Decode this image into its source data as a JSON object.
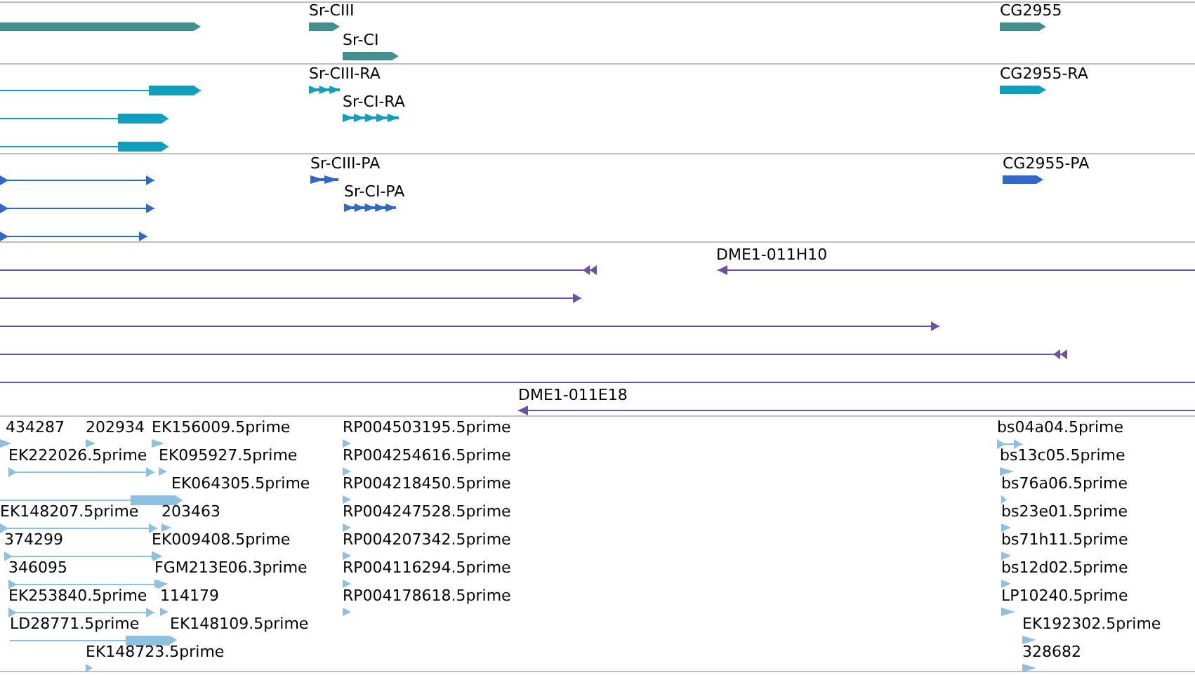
{
  "tracks": [
    {
      "kind": "gene",
      "features": [
        {
          "label": "Sr-CIII"
        },
        {
          "label": "Sr-CI"
        },
        {
          "label": "CG2955"
        }
      ]
    },
    {
      "kind": "transcript",
      "features": [
        {
          "label": "Sr-CIII-RA"
        },
        {
          "label": "Sr-CI-RA"
        },
        {
          "label": "CG2955-RA"
        }
      ]
    },
    {
      "kind": "protein",
      "features": [
        {
          "label": "Sr-CIII-PA"
        },
        {
          "label": "Sr-CI-PA"
        },
        {
          "label": "CG2955-PA"
        }
      ]
    },
    {
      "kind": "clone",
      "features": [
        {
          "label": "DME1-011H10"
        },
        {
          "label": "DME1-011E18"
        }
      ]
    },
    {
      "kind": "est",
      "features": [
        {
          "label": "434287"
        },
        {
          "label": "202934"
        },
        {
          "label": "EK156009.5prime"
        },
        {
          "label": "RP004503195.5prime"
        },
        {
          "label": "bs04a04.5prime"
        },
        {
          "label": "EK222026.5prime"
        },
        {
          "label": "EK095927.5prime"
        },
        {
          "label": "RP004254616.5prime"
        },
        {
          "label": "bs13c05.5prime"
        },
        {
          "label": "EK064305.5prime"
        },
        {
          "label": "RP004218450.5prime"
        },
        {
          "label": "bs76a06.5prime"
        },
        {
          "label": "EK148207.5prime"
        },
        {
          "label": "203463"
        },
        {
          "label": "RP004247528.5prime"
        },
        {
          "label": "bs23e01.5prime"
        },
        {
          "label": "374299"
        },
        {
          "label": "EK009408.5prime"
        },
        {
          "label": "RP004207342.5prime"
        },
        {
          "label": "bs71h11.5prime"
        },
        {
          "label": "346095"
        },
        {
          "label": "FGM213E06.3prime"
        },
        {
          "label": "RP004116294.5prime"
        },
        {
          "label": "bs12d02.5prime"
        },
        {
          "label": "EK253840.5prime"
        },
        {
          "label": "114179"
        },
        {
          "label": "RP004178618.5prime"
        },
        {
          "label": "LP10240.5prime"
        },
        {
          "label": "LD28771.5prime"
        },
        {
          "label": "EK148109.5prime"
        },
        {
          "label": "EK192302.5prime"
        },
        {
          "label": "EK148723.5prime"
        },
        {
          "label": "328682"
        }
      ]
    }
  ]
}
